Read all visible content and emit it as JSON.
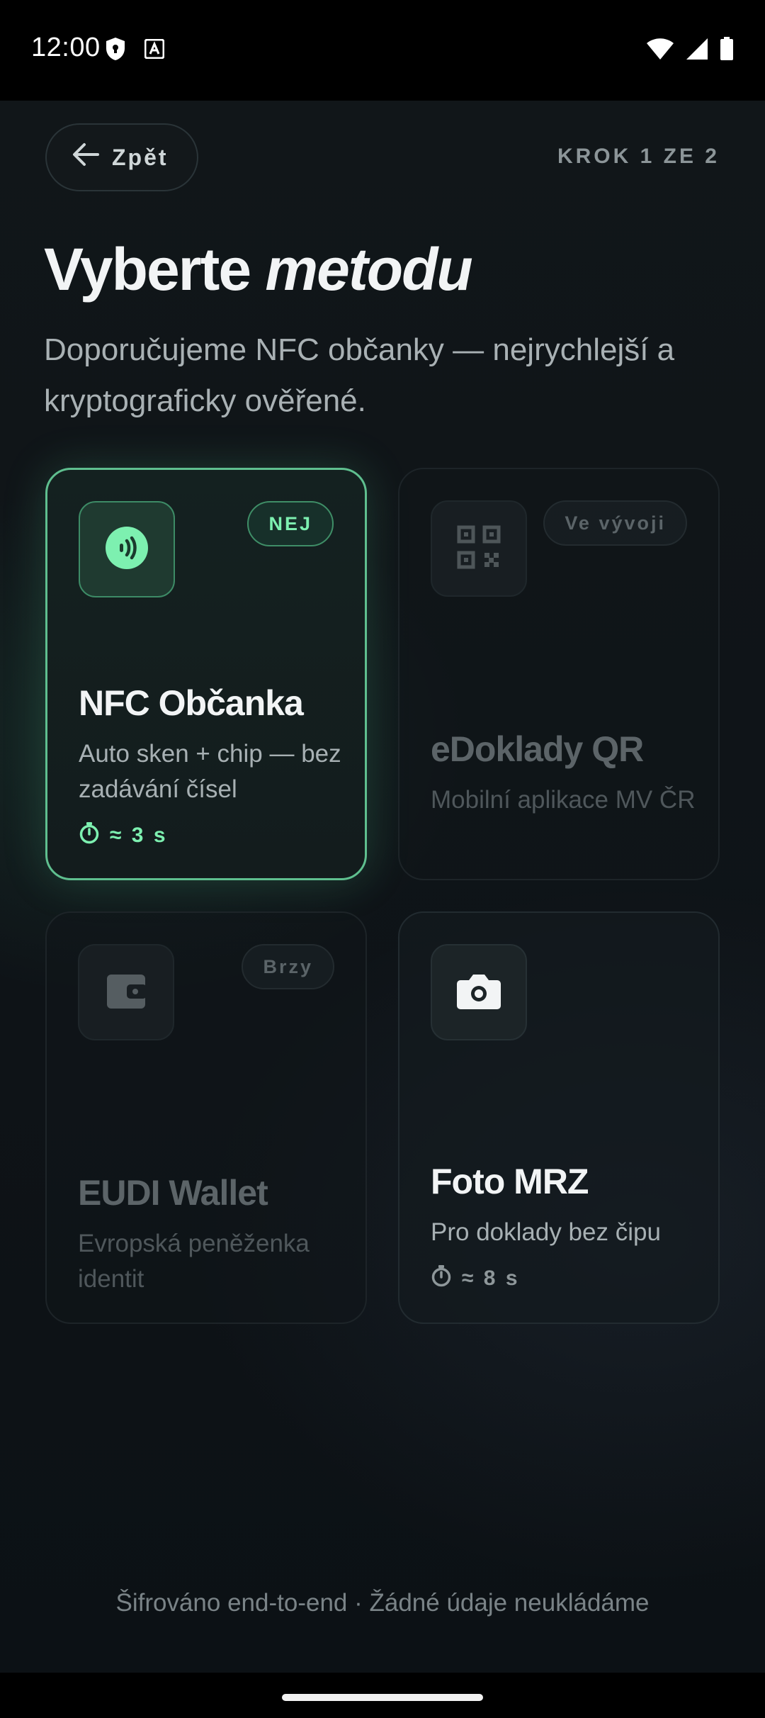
{
  "status_bar": {
    "time": "12:00"
  },
  "header": {
    "back_label": "Zpět",
    "step_label": "KROK 1 ZE 2"
  },
  "title": {
    "main": "Vyberte",
    "emphasis": "metodu"
  },
  "subtitle": "Doporučujeme NFC občanky — nejrychlejší a kryptograficky ověřené.",
  "methods": [
    {
      "title": "NFC Občanka",
      "description": "Auto sken + chip — bez zadávání čísel",
      "badge": "NEJ",
      "time": "≈ 3 s",
      "icon": "nfc-icon",
      "state": "selected"
    },
    {
      "title": "eDoklady QR",
      "description": "Mobilní aplikace MV ČR",
      "badge": "Ve vývoji",
      "icon": "qr-code-icon",
      "state": "disabled"
    },
    {
      "title": "EUDI Wallet",
      "description": "Evropská peněženka identit",
      "badge": "Brzy",
      "icon": "wallet-icon",
      "state": "disabled"
    },
    {
      "title": "Foto MRZ",
      "description": "Pro doklady bez čipu",
      "time": "≈ 8 s",
      "icon": "camera-icon",
      "state": "available"
    }
  ],
  "footer": "Šifrováno end-to-end · Žádné údaje neukládáme",
  "colors": {
    "accent": "#7df0b0",
    "accent_border": "#5fbf8f",
    "background": "#0f1418"
  }
}
